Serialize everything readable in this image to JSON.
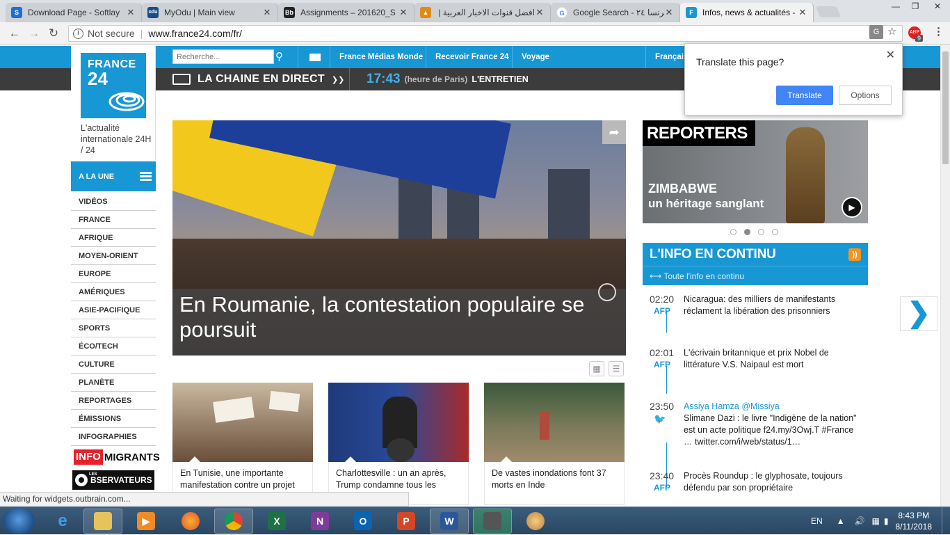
{
  "browser": {
    "tabs": [
      {
        "label": "Download Page - Softlay",
        "icon_color": "#1d6fd6",
        "icon_text": "S"
      },
      {
        "label": "MyOdu | Main view",
        "icon_color": "#1a4c8c",
        "icon_text": "odu"
      },
      {
        "label": "Assignments – 201620_S",
        "icon_color": "#222222",
        "icon_text": "Bb"
      },
      {
        "label": "افضل قنوات الاخبار العربية | ال",
        "icon_color": "#e08a14",
        "icon_text": "▲"
      },
      {
        "label": "Google Search - فرنسا ٢٤",
        "icon_color": "#ffffff",
        "icon_text": "G"
      },
      {
        "label": "Infos, news & actualités -",
        "icon_color": "#1897d5",
        "icon_text": "F"
      }
    ],
    "security": "Not secure",
    "url": "www.france24.com/fr/",
    "ext_badge": "9"
  },
  "site": {
    "logo_line1": "FRANCE",
    "logo_line2": "24",
    "tagline": "L'actualité internationale 24H / 24",
    "search_placeholder": "Recherche...",
    "topnav": [
      "France Médias Monde",
      "Recevoir France 24",
      "Voyage",
      "Français"
    ],
    "live_label": "LA CHAINE EN DIRECT",
    "clock_time": "17:43",
    "clock_paris": "(heure de Paris)",
    "clock_show": "L'ENTRETIEN",
    "menu_head": "A LA UNE",
    "menu": [
      "VIDÉOS",
      "FRANCE",
      "AFRIQUE",
      "MOYEN-ORIENT",
      "EUROPE",
      "AMÉRIQUES",
      "ASIE-PACIFIQUE",
      "SPORTS",
      "ÉCO/TECH",
      "CULTURE",
      "PLANÈTE",
      "REPORTAGES",
      "ÉMISSIONS",
      "INFOGRAPHIES"
    ],
    "infomigrants_a": "INFO",
    "infomigrants_b": "MIGRANTS",
    "observateurs_small": "LES",
    "observateurs": "BSERVATEURS",
    "hero_title": "En Roumanie, la contestation populaire se poursuit",
    "cards": [
      "En Tunisie, une importante manifestation contre un projet",
      "Charlottesville : un an après, Trump condamne tous les",
      "De vastes inondations font 37 morts en Inde"
    ],
    "reporters_logo": "REPORTERS",
    "reporters_k1": "ZIMBABWE",
    "reporters_k2": "un héritage sanglant",
    "continu_title": "L'INFO EN CONTINU",
    "continu_sub": "Toute l'info en continu",
    "news": [
      {
        "time": "02:20",
        "src": "AFP",
        "author": "",
        "text": "Nicaragua: des milliers de manifestants réclament la libération des prisonniers"
      },
      {
        "time": "02:01",
        "src": "AFP",
        "author": "",
        "text": "L'écrivain britannique et prix Nobel de littérature V.S. Naipaul est mort"
      },
      {
        "time": "23:50",
        "src": "",
        "author": "Assiya Hamza @Missiya",
        "text": "Slimane Dazi : le livre \"Indigène de la nation\" est un acte politique f24.my/3Owj.T #France … twitter.com/i/web/status/1…"
      },
      {
        "time": "23:40",
        "src": "AFP",
        "author": "",
        "text": "Procès Roundup : le glyphosate, toujours défendu par son propriétaire"
      }
    ]
  },
  "translate": {
    "question": "Translate this page?",
    "translate_btn": "Translate",
    "options_btn": "Options"
  },
  "status_text": "Waiting for widgets.outbrain.com...",
  "taskbar": {
    "lang": "EN",
    "time": "8:43 PM",
    "date": "8/11/2018"
  },
  "colors": {
    "brand": "#1897d5",
    "dark_bar": "#3c3c3c",
    "translate_blue": "#4285f4"
  }
}
